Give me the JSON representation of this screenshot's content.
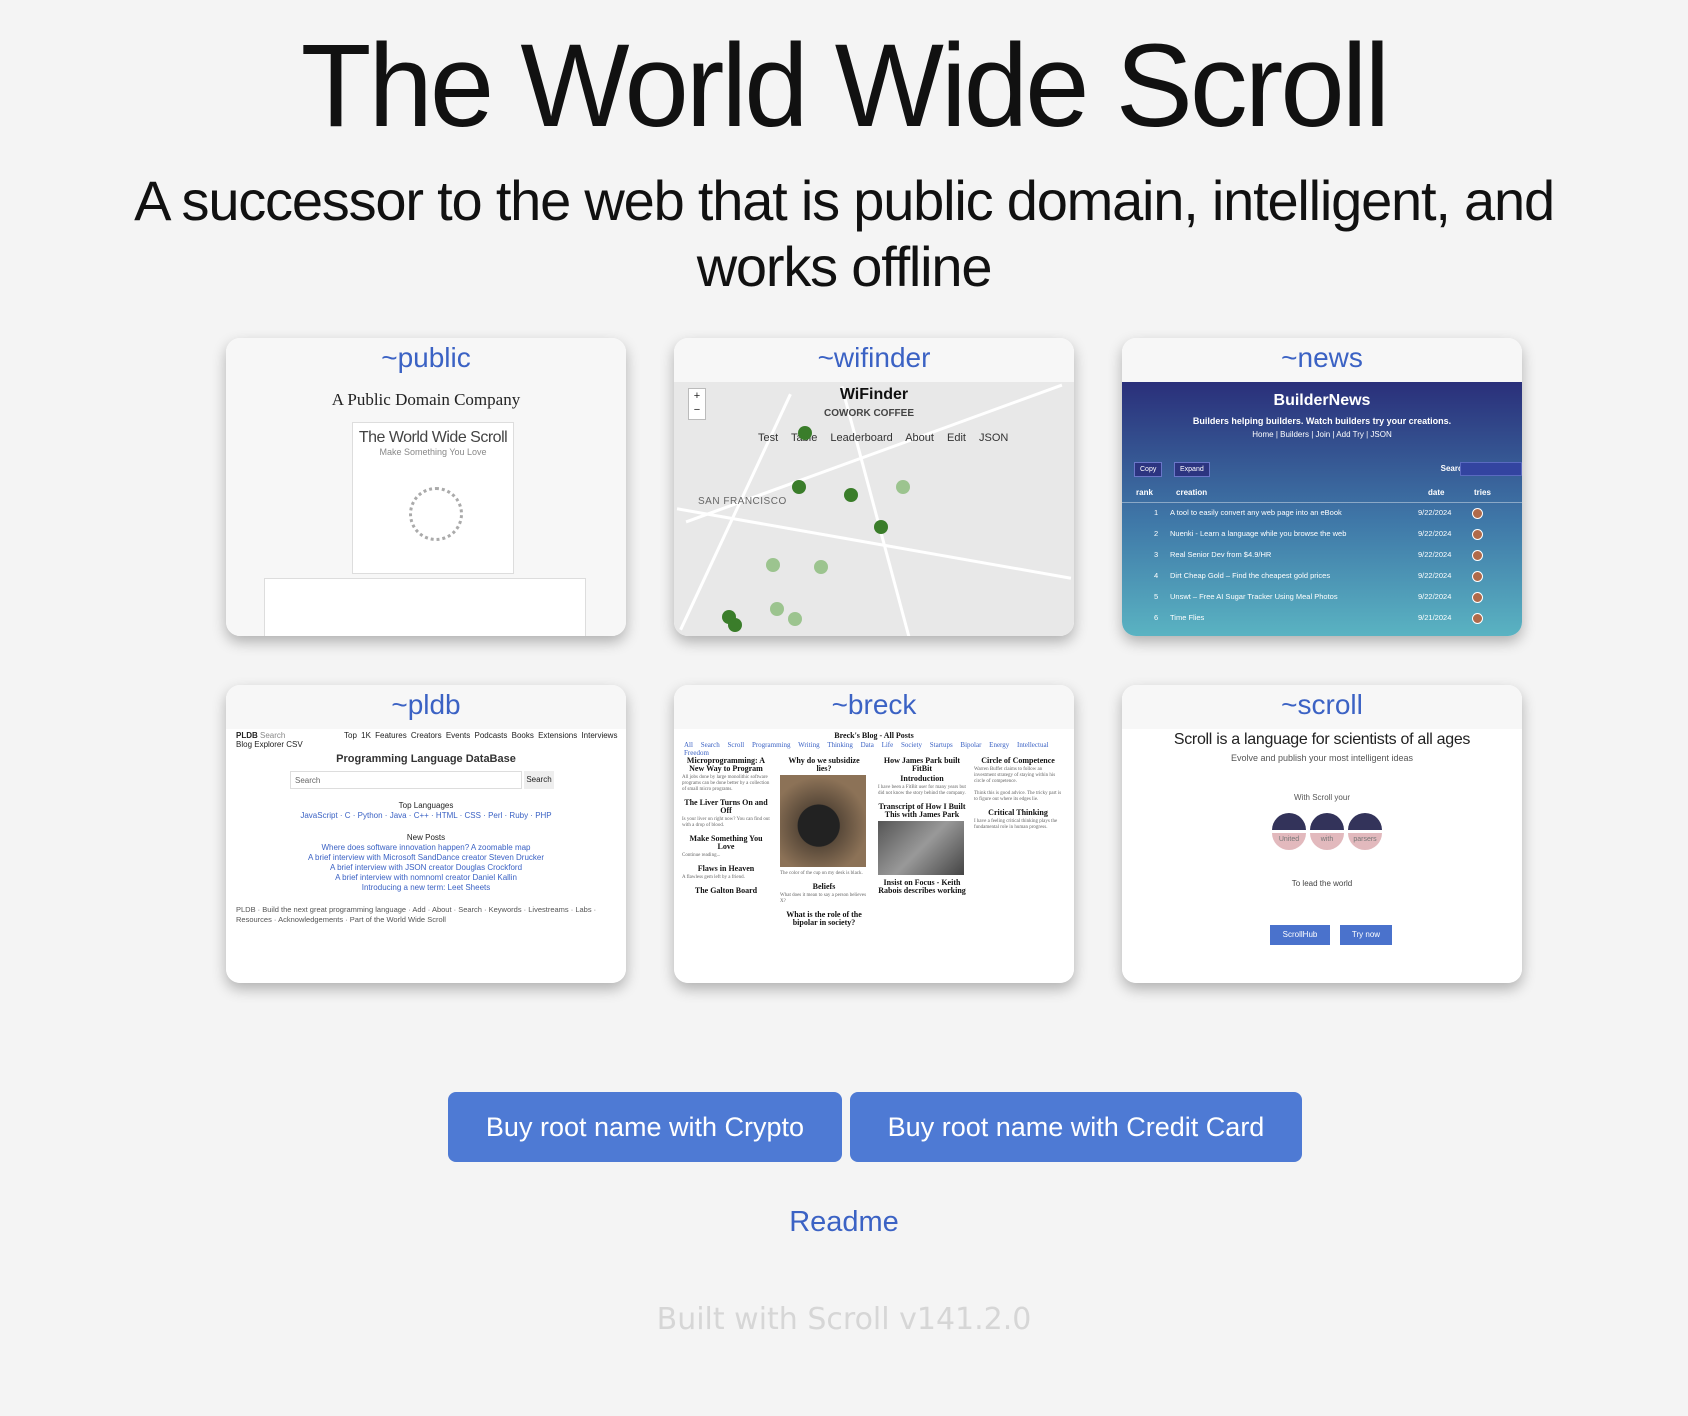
{
  "header": {
    "title": "The World Wide Scroll",
    "subtitle": "A successor to the web that is public domain, intelligent, and works offline"
  },
  "cards": {
    "public": {
      "label": "~public",
      "heading": "A Public Domain Company",
      "book_title": "The World Wide Scroll",
      "book_sub": "Make Something You Love"
    },
    "wifinder": {
      "label": "~wifinder",
      "title": "WiFinder",
      "place": "COWORK COFFEE",
      "nav": "Test Table Leaderboard About Edit JSON",
      "city": "SAN FRANCISCO"
    },
    "news": {
      "label": "~news",
      "title": "BuilderNews",
      "tagline": "Builders helping builders. Watch builders try your creations.",
      "nav": "Home | Builders | Join | Add Try | JSON",
      "copy": "Copy",
      "expand": "Expand",
      "search": "Search:",
      "search_placeholder": "Search",
      "col_rank": "rank",
      "col_creation": "creation",
      "col_date": "date",
      "col_tries": "tries",
      "rows": [
        {
          "rank": "1",
          "creation": "A tool to easily convert any web page into an eBook",
          "date": "9/22/2024"
        },
        {
          "rank": "2",
          "creation": "Nuenki - Learn a language while you browse the web",
          "date": "9/22/2024"
        },
        {
          "rank": "3",
          "creation": "Real Senior Dev from $4.9/HR",
          "date": "9/22/2024"
        },
        {
          "rank": "4",
          "creation": "Dirt Cheap Gold – Find the cheapest gold prices",
          "date": "9/22/2024"
        },
        {
          "rank": "5",
          "creation": "Unswt – Free AI Sugar Tracker Using Meal Photos",
          "date": "9/22/2024"
        },
        {
          "rank": "6",
          "creation": "Time Flies",
          "date": "9/21/2024"
        }
      ]
    },
    "pldb": {
      "label": "~pldb",
      "brand": "PLDB",
      "brand_search": "Search",
      "brand_line2": "Blog  Explorer  CSV",
      "topnav": "Top 1K  Features  Creators  Events  Podcasts  Books  Extensions  Interviews",
      "heading": "Programming Language DataBase",
      "search_placeholder": "Search",
      "search_button": "Search",
      "top_languages": "Top Languages",
      "languages": "JavaScript · C · Python · Java · C++ · HTML · CSS · Perl · Ruby · PHP",
      "new_posts": "New Posts",
      "posts": [
        "Where does software innovation happen? A zoomable map",
        "A brief interview with Microsoft SandDance creator Steven Drucker",
        "A brief interview with JSON creator Douglas Crockford",
        "A brief interview with nomnoml creator Daniel Kallin",
        "Introducing a new term: Leet Sheets"
      ],
      "footer": "PLDB · Build the next great programming language · Add · About · Search · Keywords · Livestreams · Labs · Resources · Acknowledgements · Part of the World Wide Scroll"
    },
    "breck": {
      "label": "~breck",
      "heading": "Breck's Blog - All Posts",
      "nav": "All Search Scroll Programming Writing Thinking Data Life Society Startups Bipolar Energy Intellectual Freedom",
      "col1": [
        "Microprogramming: A New Way to Program",
        "The Liver Turns On and Off",
        "Make Something You Love",
        "Flaws in Heaven",
        "The Galton Board"
      ],
      "col2": [
        "Why do we subsidize lies?",
        "Beliefs",
        "What is the role of the bipolar in society?"
      ],
      "col3": [
        "How James Park built FitBit",
        "Introduction",
        "Transcript of How I Built This with James Park",
        "Insist on Focus - Keith Rabois describes working"
      ],
      "col4": [
        "Circle of Competence",
        "Critical Thinking"
      ]
    },
    "scroll": {
      "label": "~scroll",
      "heading": "Scroll is a language for scientists of all ages",
      "sub": "Evolve and publish your most intelligent ideas",
      "with": "With Scroll your",
      "circles": [
        "United",
        "with",
        "parsers"
      ],
      "lead": "To lead the world",
      "btn1": "ScrollHub",
      "btn2": "Try now"
    }
  },
  "actions": {
    "crypto": "Buy root name with Crypto",
    "card": "Buy root name with Credit Card",
    "readme": "Readme"
  },
  "footer": {
    "built": "Built with Scroll v141.2.0"
  }
}
